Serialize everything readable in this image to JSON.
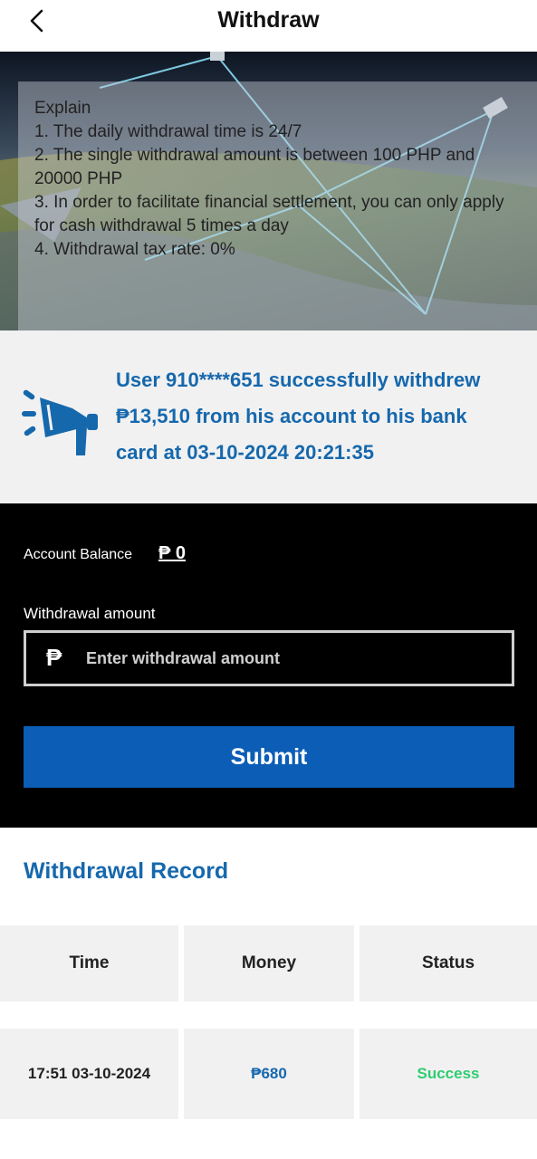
{
  "header": {
    "title": "Withdraw",
    "back_icon": "chevron-left-icon"
  },
  "explain": {
    "title": "Explain",
    "lines": [
      "1. The daily withdrawal time is 24/7",
      "2. The single withdrawal amount is between 100 PHP and 20000 PHP",
      "3. In order to facilitate financial settlement, you can only apply for cash withdrawal 5 times a day",
      "4. Withdrawal tax rate: 0%"
    ]
  },
  "notice": {
    "icon": "megaphone-icon",
    "text": "User 910****651 successfully withdrew ₱13,510 from his account to his bank card at 03-10-2024 20:21:35"
  },
  "form": {
    "balance_label": "Account Balance",
    "balance_value": "₱ 0",
    "amount_label": "Withdrawal amount",
    "currency_symbol": "₱",
    "amount_placeholder": "Enter withdrawal amount",
    "amount_value": "",
    "submit_label": "Submit"
  },
  "record": {
    "title": "Withdrawal Record",
    "columns": [
      "Time",
      "Money",
      "Status"
    ],
    "rows": [
      {
        "time": "17:51 03-10-2024",
        "money": "₱680",
        "status": "Success"
      }
    ]
  },
  "colors": {
    "accent_blue": "#1668ad",
    "button_blue": "#0b5db6",
    "success_green": "#2ecc71",
    "form_bg": "#000000",
    "panel_bg": "#f1f1f1"
  }
}
